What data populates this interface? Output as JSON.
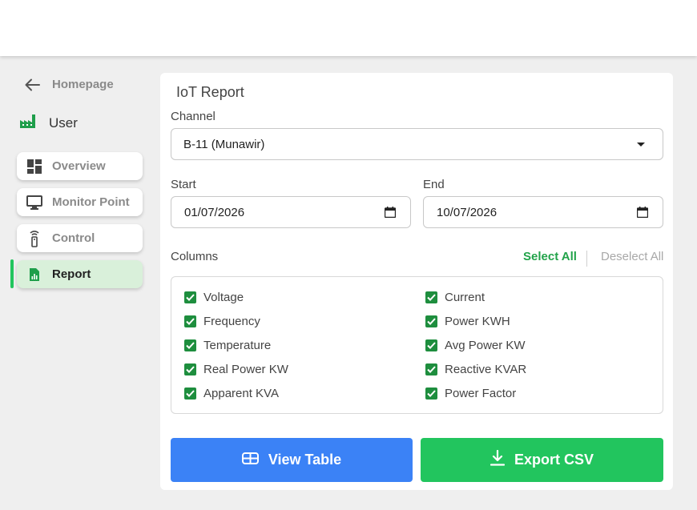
{
  "sidebar": {
    "back_label": "Homepage",
    "user_label": "User",
    "items": [
      {
        "label": "Overview",
        "icon": "dashboard-icon",
        "active": false
      },
      {
        "label": "Monitor Point",
        "icon": "monitor-icon",
        "active": false
      },
      {
        "label": "Control",
        "icon": "remote-control-icon",
        "active": false
      },
      {
        "label": "Report",
        "icon": "report-chart-icon",
        "active": true
      }
    ]
  },
  "report": {
    "title": "IoT Report",
    "channel_label": "Channel",
    "channel_value": "B-11 (Munawir)",
    "start_label": "Start",
    "start_value": "01/07/2026",
    "end_label": "End",
    "end_value": "10/07/2026",
    "columns_label": "Columns",
    "select_all": "Select All",
    "deselect_all": "Deselect All",
    "columns": [
      {
        "label": "Voltage",
        "checked": true
      },
      {
        "label": "Current",
        "checked": true
      },
      {
        "label": "Frequency",
        "checked": true
      },
      {
        "label": "Power KWH",
        "checked": true
      },
      {
        "label": "Temperature",
        "checked": true
      },
      {
        "label": "Avg Power KW",
        "checked": true
      },
      {
        "label": "Real Power KW",
        "checked": true
      },
      {
        "label": "Reactive KVAR",
        "checked": true
      },
      {
        "label": "Apparent KVA",
        "checked": true
      },
      {
        "label": "Power Factor",
        "checked": true
      }
    ],
    "view_table": "View Table",
    "export_csv": "Export CSV"
  },
  "colors": {
    "accent_green": "#22c55e",
    "primary_blue": "#3b82f6",
    "checkbox_green": "#1e8e3e",
    "active_nav_bg": "#d9f0da"
  }
}
